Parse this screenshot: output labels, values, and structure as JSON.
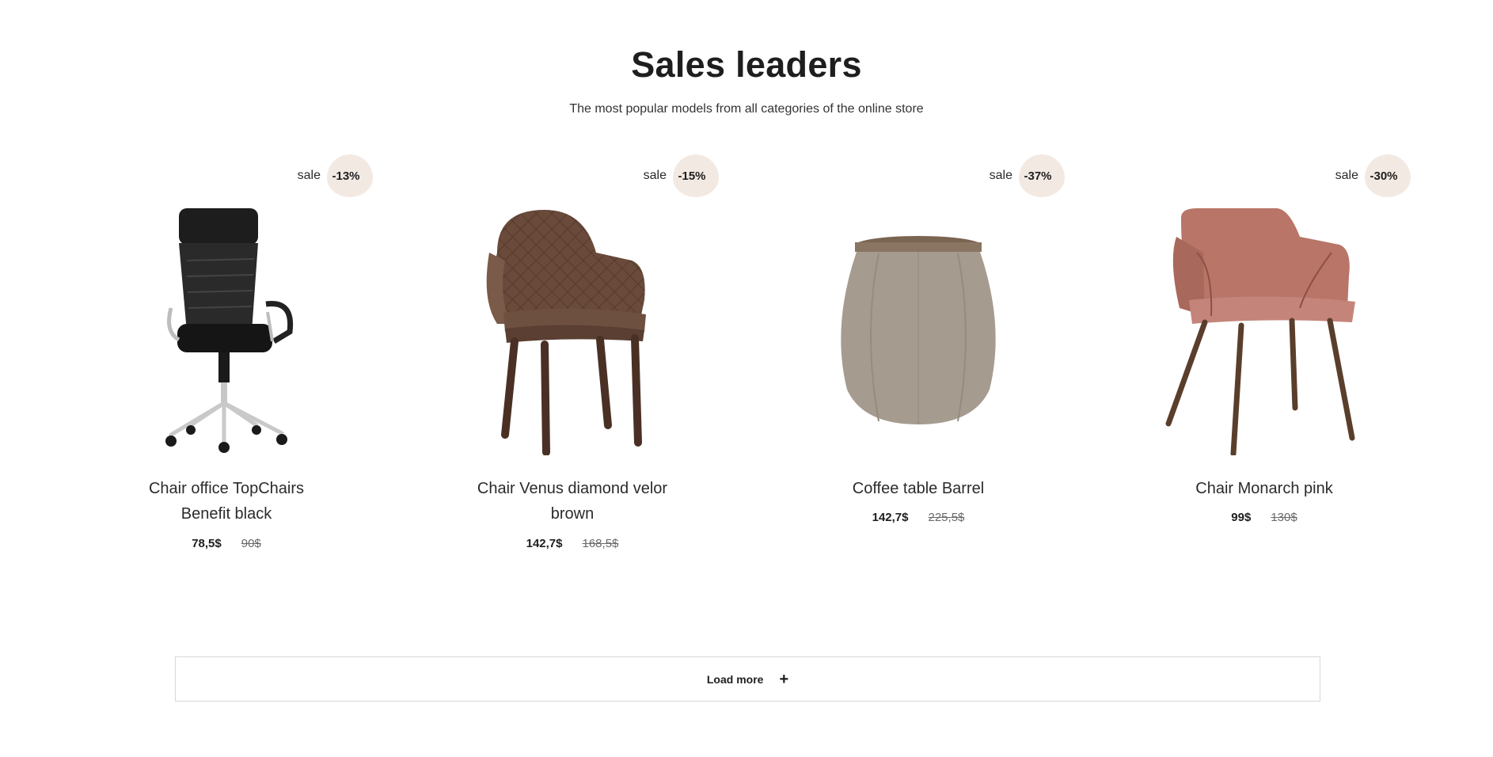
{
  "section": {
    "title": "Sales leaders",
    "subtitle": "The most popular models from all categories of the online store"
  },
  "sale_word": "sale",
  "products": [
    {
      "name_line1": "Chair office TopChairs",
      "name_line2": "Benefit black",
      "discount": "-13%",
      "price": "78,5$",
      "old_price": "90$",
      "image_icon": "office-chair-icon"
    },
    {
      "name_line1": "Chair Venus diamond velor",
      "name_line2": "brown",
      "discount": "-15%",
      "price": "142,7$",
      "old_price": "168,5$",
      "image_icon": "armchair-brown-icon"
    },
    {
      "name_line1": "Coffee table Barrel",
      "name_line2": "",
      "discount": "-37%",
      "price": "142,7$",
      "old_price": "225,5$",
      "image_icon": "barrel-table-icon"
    },
    {
      "name_line1": "Chair Monarch pink",
      "name_line2": "",
      "discount": "-30%",
      "price": "99$",
      "old_price": "130$",
      "image_icon": "armchair-pink-icon"
    }
  ],
  "load_more": {
    "label": "Load more",
    "icon": "plus-icon"
  },
  "colors": {
    "sale_blob": "#f3e9e3",
    "text": "#1e1e1e",
    "border": "#d8d8d8"
  }
}
